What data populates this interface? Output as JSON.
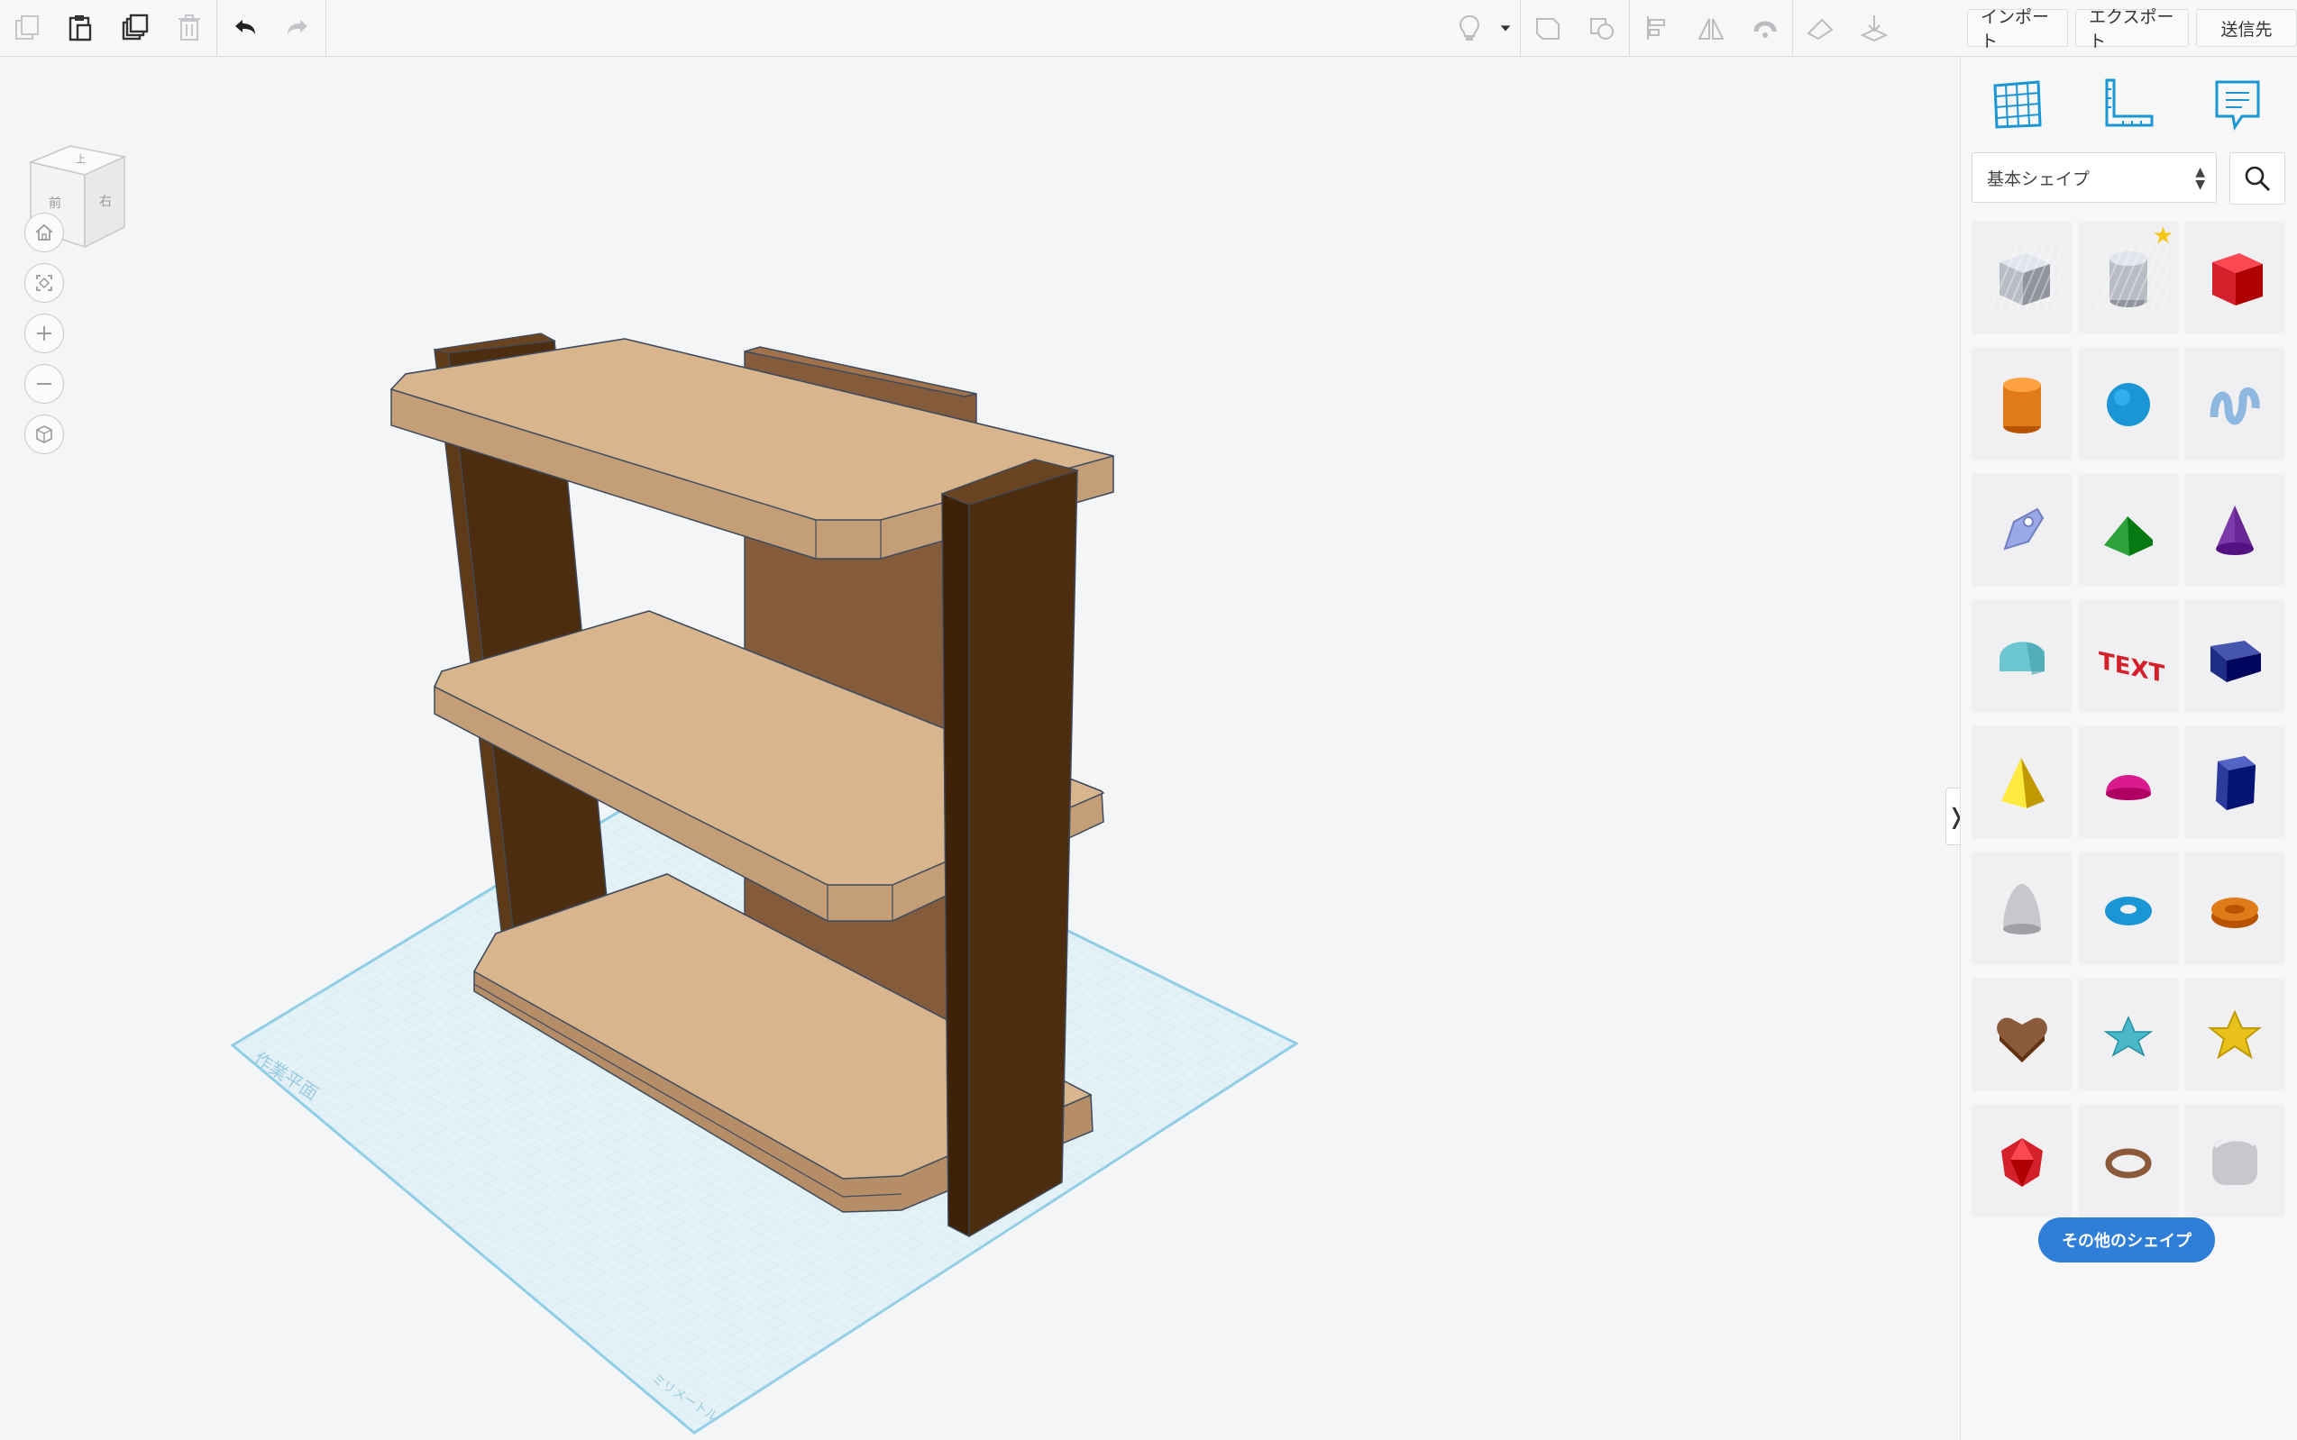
{
  "toolbar": {
    "left_tools": [
      "copy-icon",
      "paste-icon",
      "duplicate-icon",
      "delete-icon",
      "undo-icon",
      "redo-icon"
    ],
    "right_tools": [
      "lightbulb-icon",
      "dropdown-caret-icon",
      "group-icon",
      "ungroup-icon",
      "align-icon",
      "mirror-icon",
      "magnet-icon",
      "ruler-workplane-icon",
      "drop-to-workplane-icon"
    ]
  },
  "actions": {
    "import": "インポート",
    "export": "エクスポート",
    "send_to": "送信先"
  },
  "view_cube": {
    "front_label": "前",
    "right_label": "右",
    "top_label": "上"
  },
  "nav_buttons": [
    "home-icon",
    "fit-icon",
    "zoom-in-icon",
    "zoom-out-icon",
    "perspective-icon"
  ],
  "workplane": {
    "label": "作業平面",
    "unit_label": "ミリメートル"
  },
  "panel": {
    "top_icons": [
      "grid-view-icon",
      "ruler-icon",
      "notes-icon"
    ],
    "category": "基本シェイプ",
    "more_shapes": "その他のシェイプ",
    "shapes": [
      {
        "name": "box-hole-shape",
        "color": "#b8bcc4"
      },
      {
        "name": "cylinder-hole-shape",
        "color": "#b8bcc4"
      },
      {
        "name": "box-shape",
        "color": "#d4202a"
      },
      {
        "name": "cylinder-shape",
        "color": "#e07b1a"
      },
      {
        "name": "sphere-shape",
        "color": "#1b96d4"
      },
      {
        "name": "scribble-shape",
        "color": "#8fb8e0"
      },
      {
        "name": "shape-generator-pen",
        "color": "#9aa8e8"
      },
      {
        "name": "roof-shape",
        "color": "#2ea23a"
      },
      {
        "name": "cone-shape",
        "color": "#7b3aa8"
      },
      {
        "name": "round-roof-shape",
        "color": "#6ac6d2"
      },
      {
        "name": "text-shape",
        "color": "#d4202a"
      },
      {
        "name": "wedge-shape",
        "color": "#1e2d86"
      },
      {
        "name": "pyramid-shape",
        "color": "#e8c21a"
      },
      {
        "name": "half-sphere-shape",
        "color": "#d81a8c"
      },
      {
        "name": "polygon-shape",
        "color": "#2b3c9c"
      },
      {
        "name": "paraboloid-shape",
        "color": "#c8c8cc"
      },
      {
        "name": "torus-shape",
        "color": "#1b96d4"
      },
      {
        "name": "tube-shape",
        "color": "#e07b1a"
      },
      {
        "name": "heart-shape",
        "color": "#8a5a3a"
      },
      {
        "name": "star-shape",
        "color": "#4ab8c8"
      },
      {
        "name": "star-thick-shape",
        "color": "#e8c21a"
      },
      {
        "name": "icosahedron-shape",
        "color": "#d4202a"
      },
      {
        "name": "ring-shape",
        "color": "#8a5a3a"
      },
      {
        "name": "rounded-box-shape",
        "color": "#c8c8cc"
      }
    ]
  }
}
